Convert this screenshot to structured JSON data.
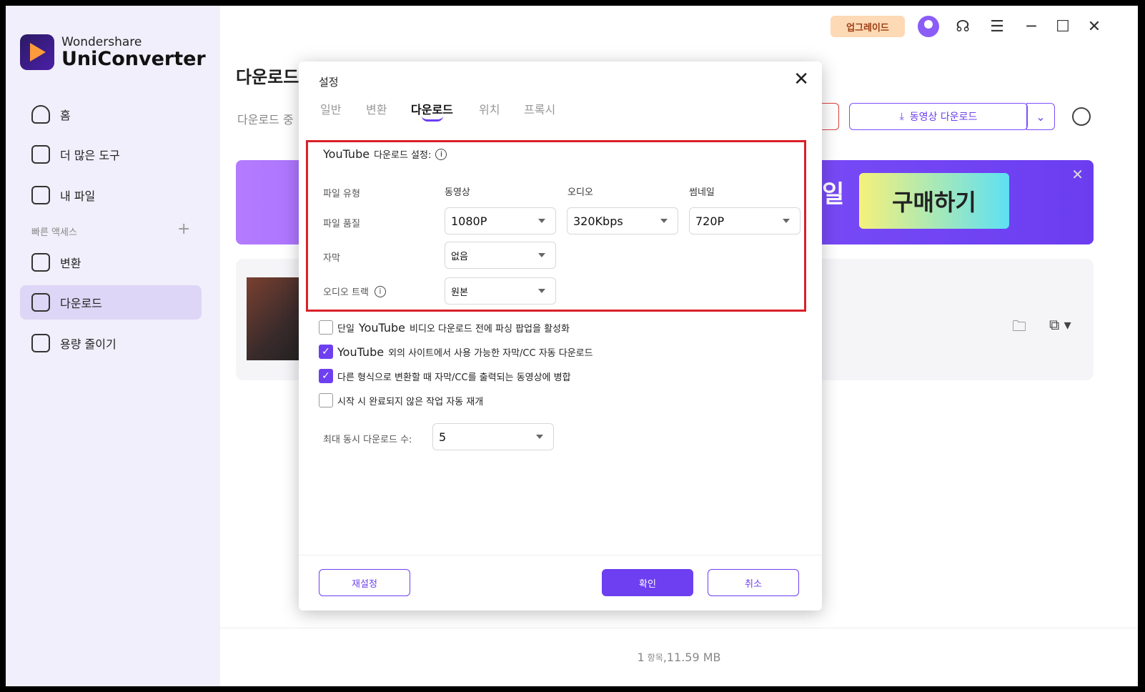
{
  "app": {
    "brand_line1": "Wondershare",
    "brand_line2": "UniConverter"
  },
  "sidebar": {
    "items": [
      {
        "label": "홈",
        "icon": "home-icon"
      },
      {
        "label": "더 많은 도구",
        "icon": "toolbox-icon"
      },
      {
        "label": "내 파일",
        "icon": "file-icon"
      },
      {
        "label": "변환",
        "icon": "convert-icon"
      },
      {
        "label": "다운로드",
        "icon": "download-icon"
      },
      {
        "label": "용량 줄이기",
        "icon": "compress-icon"
      }
    ],
    "quick_access": "빠른 액세스"
  },
  "topbar": {
    "upgrade": "업그레이드"
  },
  "main": {
    "title": "다운로드",
    "subtab": "다운로드 중",
    "download_video": "동영상 다운로드",
    "banner_text": "일",
    "buy": "구매하기",
    "footer_count": "1",
    "footer_items": "항목",
    "footer_size": ",11.59 MB"
  },
  "dialog": {
    "title": "설정",
    "tabs": [
      "일반",
      "변환",
      "다운로드",
      "위치",
      "프록시"
    ],
    "yt_label": "YouTube",
    "yt_sub": "다운로드 설정:",
    "file_type": "파일 유형",
    "file_quality": "파일 품질",
    "subtitle": "자막",
    "audio_track": "오디오 트랙",
    "col_video": "동영상",
    "col_audio": "오디오",
    "col_thumb": "썸네일",
    "video_quality": "1080P",
    "audio_quality": "320Kbps",
    "thumb_quality": "720P",
    "subtitle_value": "없음",
    "audio_track_value": "원본",
    "checks": [
      {
        "pre": "단일 ",
        "big": "YouTube",
        "post": " 비디오 다운로드 전에 파싱 팝업을 활성화",
        "checked": false
      },
      {
        "pre": "",
        "big": "YouTube",
        "post": " 외의 사이트에서 사용 가능한 자막/CC 자동 다운로드",
        "checked": true
      },
      {
        "pre": "다른 형식으로 변환할 때 자막/CC를 출력되는 동영상에 병합",
        "big": "",
        "post": "",
        "checked": true
      },
      {
        "pre": "시작 시 완료되지 않은 작업 자동 재개",
        "big": "",
        "post": "",
        "checked": false
      }
    ],
    "max_concurrent_label": "최대 동시 다운로드 수:",
    "max_concurrent_value": "5",
    "reset": "재설정",
    "ok": "확인",
    "cancel": "취소"
  },
  "colors": {
    "accent": "#6d3ff0",
    "highlight": "#d9202a"
  }
}
